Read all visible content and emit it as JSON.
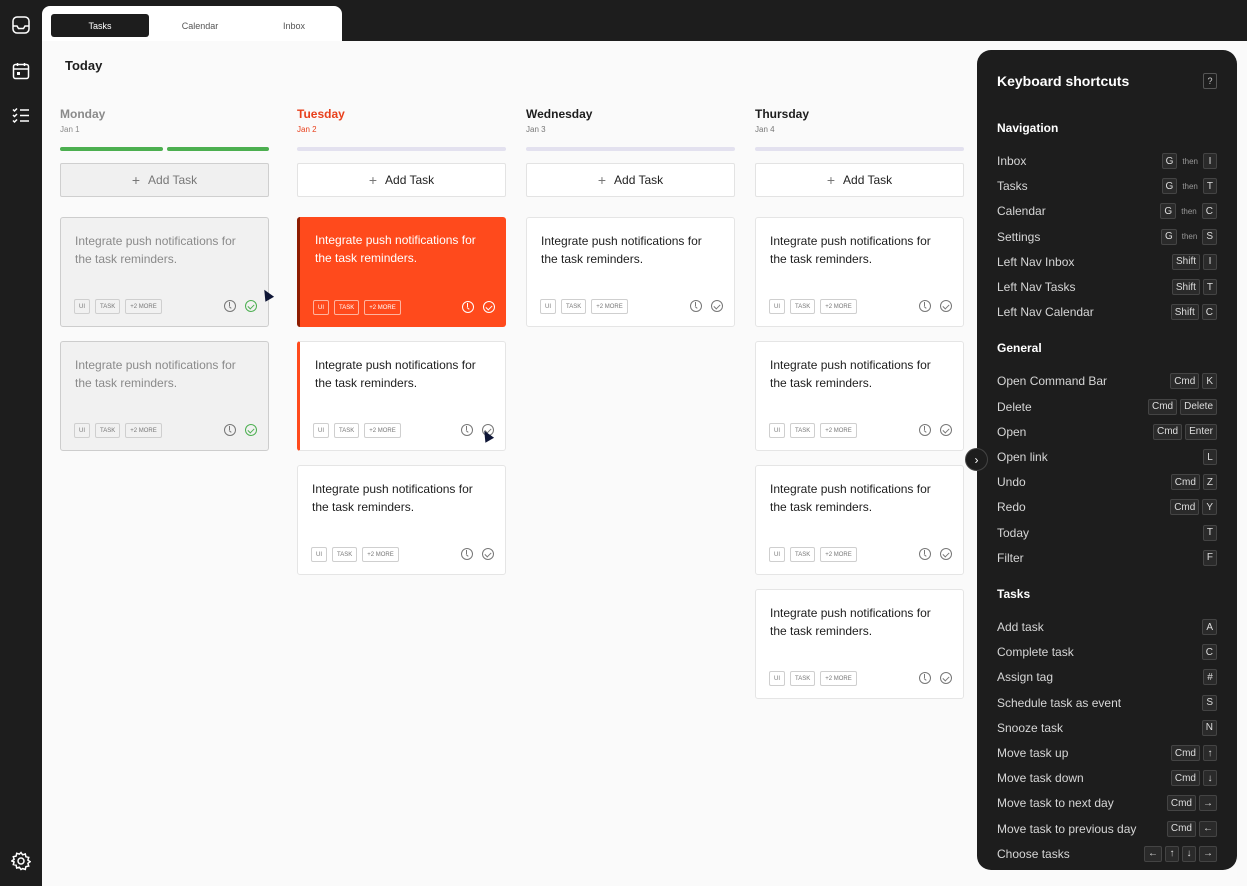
{
  "tabs": [
    "Tasks",
    "Calendar",
    "Inbox"
  ],
  "page_title": "Today",
  "columns": [
    {
      "day": "Monday",
      "date": "Jan 1",
      "state": "past",
      "progress": [
        true,
        true
      ],
      "add_label": "Add Task",
      "cards": [
        {
          "title": "Integrate push notifications for the task reminders.",
          "tags": [
            "UI",
            "TASK",
            "+2 MORE"
          ],
          "style": "faded"
        },
        {
          "title": "Integrate push notifications for the task reminders.",
          "tags": [
            "UI",
            "TASK",
            "+2 MORE"
          ],
          "style": "faded"
        }
      ]
    },
    {
      "day": "Tuesday",
      "date": "Jan 2",
      "state": "current",
      "progress": [
        false
      ],
      "add_label": "Add Task",
      "cards": [
        {
          "title": "Integrate push notifications for the task reminders.",
          "tags": [
            "UI",
            "TASK",
            "+2 MORE"
          ],
          "style": "red"
        },
        {
          "title": "Integrate push notifications for the task reminders.",
          "tags": [
            "UI",
            "TASK",
            "+2 MORE"
          ],
          "style": "accent"
        },
        {
          "title": "Integrate push notifications for the task reminders.",
          "tags": [
            "UI",
            "TASK",
            "+2 MORE"
          ],
          "style": "plain"
        }
      ]
    },
    {
      "day": "Wednesday",
      "date": "Jan 3",
      "state": "future",
      "progress": [
        false
      ],
      "add_label": "Add Task",
      "cards": [
        {
          "title": "Integrate push notifications for the task reminders.",
          "tags": [
            "UI",
            "TASK",
            "+2 MORE"
          ],
          "style": "plain"
        }
      ]
    },
    {
      "day": "Thursday",
      "date": "Jan 4",
      "state": "future",
      "progress": [
        false
      ],
      "add_label": "Add Task",
      "cards": [
        {
          "title": "Integrate push notifications for the task reminders.",
          "tags": [
            "UI",
            "TASK",
            "+2 MORE"
          ],
          "style": "plain"
        },
        {
          "title": "Integrate push notifications for the task reminders.",
          "tags": [
            "UI",
            "TASK",
            "+2 MORE"
          ],
          "style": "plain"
        },
        {
          "title": "Integrate push notifications for the task reminders.",
          "tags": [
            "UI",
            "TASK",
            "+2 MORE"
          ],
          "style": "plain"
        },
        {
          "title": "Integrate push notifications for the task reminders.",
          "tags": [
            "UI",
            "TASK",
            "+2 MORE"
          ],
          "style": "plain"
        }
      ]
    }
  ],
  "shortcuts": {
    "title": "Keyboard shortcuts",
    "help_key": "?",
    "sections": [
      {
        "name": "Navigation",
        "items": [
          {
            "label": "Inbox",
            "keys": [
              "G",
              "then",
              "I"
            ]
          },
          {
            "label": "Tasks",
            "keys": [
              "G",
              "then",
              "T"
            ]
          },
          {
            "label": "Calendar",
            "keys": [
              "G",
              "then",
              "C"
            ]
          },
          {
            "label": "Settings",
            "keys": [
              "G",
              "then",
              "S"
            ]
          },
          {
            "label": "Left Nav Inbox",
            "keys": [
              "Shift",
              "I"
            ]
          },
          {
            "label": "Left Nav Tasks",
            "keys": [
              "Shift",
              "T"
            ]
          },
          {
            "label": "Left Nav Calendar",
            "keys": [
              "Shift",
              "C"
            ]
          }
        ]
      },
      {
        "name": "General",
        "items": [
          {
            "label": "Open Command Bar",
            "keys": [
              "Cmd",
              "K"
            ]
          },
          {
            "label": "Delete",
            "keys": [
              "Cmd",
              "Delete"
            ]
          },
          {
            "label": "Open",
            "keys": [
              "Cmd",
              "Enter"
            ]
          },
          {
            "label": "Open link",
            "keys": [
              "L"
            ]
          },
          {
            "label": "Undo",
            "keys": [
              "Cmd",
              "Z"
            ]
          },
          {
            "label": "Redo",
            "keys": [
              "Cmd",
              "Y"
            ]
          },
          {
            "label": "Today",
            "keys": [
              "T"
            ]
          },
          {
            "label": "Filter",
            "keys": [
              "F"
            ]
          }
        ]
      },
      {
        "name": "Tasks",
        "items": [
          {
            "label": "Add task",
            "keys": [
              "A"
            ]
          },
          {
            "label": "Complete task",
            "keys": [
              "C"
            ]
          },
          {
            "label": "Assign tag",
            "keys": [
              "#"
            ]
          },
          {
            "label": "Schedule task as event",
            "keys": [
              "S"
            ]
          },
          {
            "label": "Snooze task",
            "keys": [
              "N"
            ]
          },
          {
            "label": "Move task up",
            "keys": [
              "Cmd",
              "↑"
            ]
          },
          {
            "label": "Move task down",
            "keys": [
              "Cmd",
              "↓"
            ]
          },
          {
            "label": "Move task to next day",
            "keys": [
              "Cmd",
              "→"
            ]
          },
          {
            "label": "Move task to previous day",
            "keys": [
              "Cmd",
              "←"
            ]
          },
          {
            "label": "Choose tasks",
            "keys": [
              "←",
              "↑",
              "↓",
              "→"
            ]
          }
        ]
      }
    ]
  },
  "colors": {
    "accent": "#ff4a1c",
    "done": "#4caf50",
    "dark": "#1d1d1d"
  }
}
